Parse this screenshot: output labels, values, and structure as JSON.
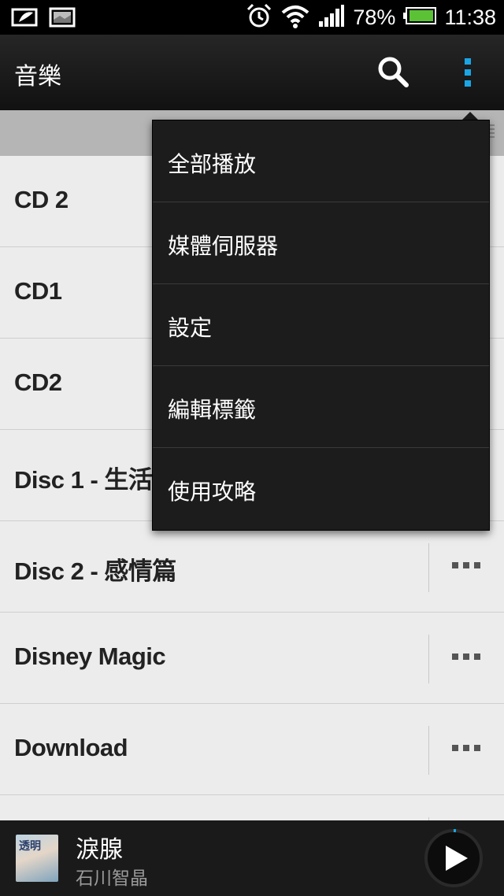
{
  "status_bar": {
    "battery_percent": "78%",
    "time": "11:38",
    "icons": [
      "htc-sense-icon",
      "gallery-icon",
      "alarm-icon",
      "wifi-icon",
      "signal-icon",
      "battery-icon"
    ],
    "battery_color": "#5bc236"
  },
  "action_bar": {
    "title": "音樂",
    "accent_color": "#1aa6e6"
  },
  "menu": {
    "items": [
      {
        "label": "全部播放"
      },
      {
        "label": "媒體伺服器"
      },
      {
        "label": "設定"
      },
      {
        "label": "編輯標籤"
      },
      {
        "label": "使用攻略"
      }
    ]
  },
  "list": {
    "rows": [
      {
        "label": "CD 2"
      },
      {
        "label": "CD1"
      },
      {
        "label": "CD2"
      },
      {
        "label": "Disc 1 - 生活篇"
      },
      {
        "label": "Disc 2 - 感情篇"
      },
      {
        "label": "Disney Magic"
      },
      {
        "label": "Download"
      }
    ]
  },
  "now_playing": {
    "title": "淚腺",
    "artist": "石川智晶",
    "art_text": "透明"
  }
}
